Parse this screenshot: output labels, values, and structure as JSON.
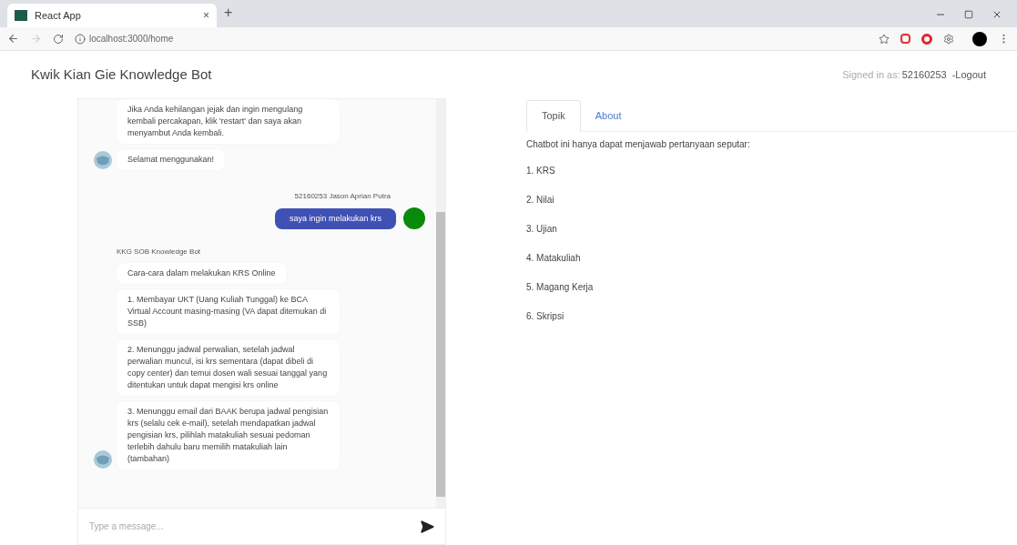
{
  "browser": {
    "tab_title": "React App",
    "tab_close": "×",
    "new_tab": "+",
    "url": "localhost:3000/home"
  },
  "header": {
    "title": "Kwik Kian Gie Knowledge Bot",
    "signed_in_label": "Signed in as:",
    "user_id": "52160253",
    "logout": "-Logout"
  },
  "chat": {
    "messages": [
      {
        "kind": "bot-message",
        "text": "Jika Anda kehilangan jejak dan ingin mengulang kembali percakapan, klik 'restart' dan saya akan menyambut Anda kembali.",
        "avatar": false
      },
      {
        "kind": "bot-message",
        "text": "Selamat menggunakan!",
        "avatar": true
      },
      {
        "kind": "user-name",
        "text": "52160253 Jason Aprian Putra"
      },
      {
        "kind": "user-message",
        "text": "saya ingin melakukan krs"
      },
      {
        "kind": "bot-name",
        "text": "KKG SOB Knowledge Bot"
      },
      {
        "kind": "bot-message",
        "text": "Cara-cara dalam melakukan KRS Online",
        "avatar": false
      },
      {
        "kind": "bot-message",
        "text": "1. Membayar UKT (Uang Kuliah Tunggal) ke BCA Virtual Account masing-masing (VA dapat ditemukan di SSB)",
        "avatar": false
      },
      {
        "kind": "bot-message",
        "text": "2. Menunggu jadwal perwalian, setelah jadwal perwalian muncul, isi krs sementara (dapat dibeli di copy center) dan temui dosen wali sesuai tanggal yang ditentukan untuk dapat mengisi krs online",
        "avatar": false
      },
      {
        "kind": "bot-message",
        "text": "3. Menunggu email dari BAAK berupa jadwal pengisian krs (selalu cek e-mail), setelah mendapatkan jadwal pengisian krs, pilihlah matakuliah sesuai pedoman terlebih dahulu baru memilih matakuliah lain (tambahan)",
        "avatar": true
      }
    ],
    "input": {
      "placeholder": "Type a message..."
    }
  },
  "tabs": [
    {
      "label": "Topik",
      "selected": true
    },
    {
      "label": "About",
      "selected": false
    }
  ],
  "topics": {
    "intro": "Chatbot ini hanya dapat menjawab pertanyaan seputar:",
    "items": [
      "1. KRS",
      "2. Nilai",
      "3. Ujian",
      "4. Matakuliah",
      "5. Magang Kerja",
      "6. Skripsi"
    ]
  }
}
